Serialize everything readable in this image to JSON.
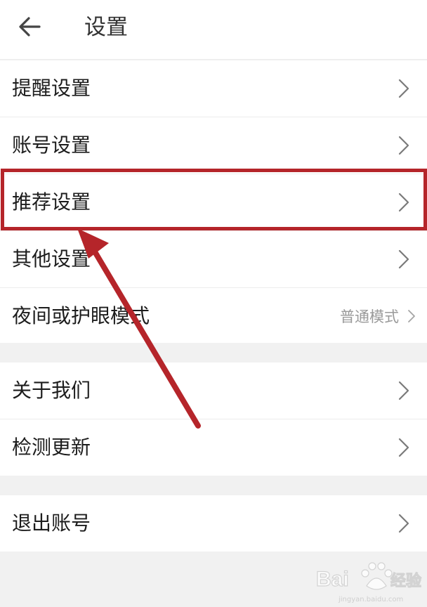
{
  "header": {
    "title": "设置",
    "back_icon": "arrow-left-icon"
  },
  "groups": [
    {
      "items": [
        {
          "label": "提醒设置",
          "icon": "chevron-right-icon"
        },
        {
          "label": "账号设置",
          "icon": "chevron-right-icon"
        },
        {
          "label": "推荐设置",
          "icon": "chevron-right-icon"
        },
        {
          "label": "其他设置",
          "icon": "chevron-right-icon"
        },
        {
          "label": "夜间或护眼模式",
          "value": "普通模式",
          "icon": "chevron-right-icon"
        }
      ]
    },
    {
      "items": [
        {
          "label": "关于我们",
          "icon": "chevron-right-icon"
        },
        {
          "label": "检测更新",
          "icon": "chevron-right-icon"
        }
      ]
    },
    {
      "items": [
        {
          "label": "退出账号",
          "icon": "chevron-right-icon"
        }
      ]
    }
  ],
  "annotation": {
    "highlight_color": "#b5252a",
    "highlighted_item": "推荐设置"
  },
  "watermark": {
    "brand": "Bai",
    "product": "经验",
    "url": "jingyan.baidu.com"
  },
  "colors": {
    "background": "#f1f1f1",
    "surface": "#ffffff",
    "text": "#1d1d1d",
    "secondary_text": "#9a9a9a",
    "chevron": "#7a7a7a"
  }
}
